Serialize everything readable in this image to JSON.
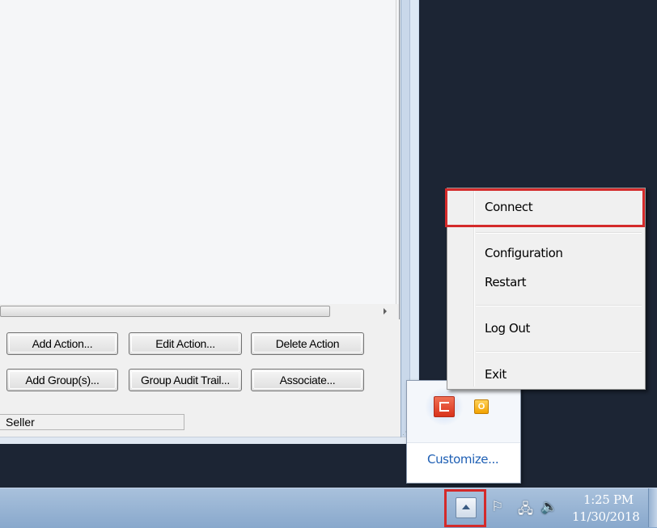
{
  "window": {
    "buttons_row1": [
      "Add Action...",
      "Edit Action...",
      "Delete Action"
    ],
    "buttons_row2": [
      "Add Group(s)...",
      "Group Audit Trail...",
      "Associate..."
    ],
    "status_field": "Seller"
  },
  "tray_popup": {
    "icons": [
      "red-app-icon",
      "outlook-icon"
    ],
    "outlook_letter": "O",
    "customize_label": "Customize..."
  },
  "context_menu": {
    "items": [
      "Connect",
      "Configuration",
      "Restart",
      "Log Out",
      "Exit"
    ],
    "highlighted_item": "Connect",
    "highlight_color": "#d42a2a"
  },
  "taskbar": {
    "tray_icons": [
      "show-hidden-icons-button",
      "action-center-flag-icon",
      "network-icon",
      "volume-icon"
    ],
    "clock_time": "1:25 PM",
    "clock_date": "11/30/2018"
  }
}
